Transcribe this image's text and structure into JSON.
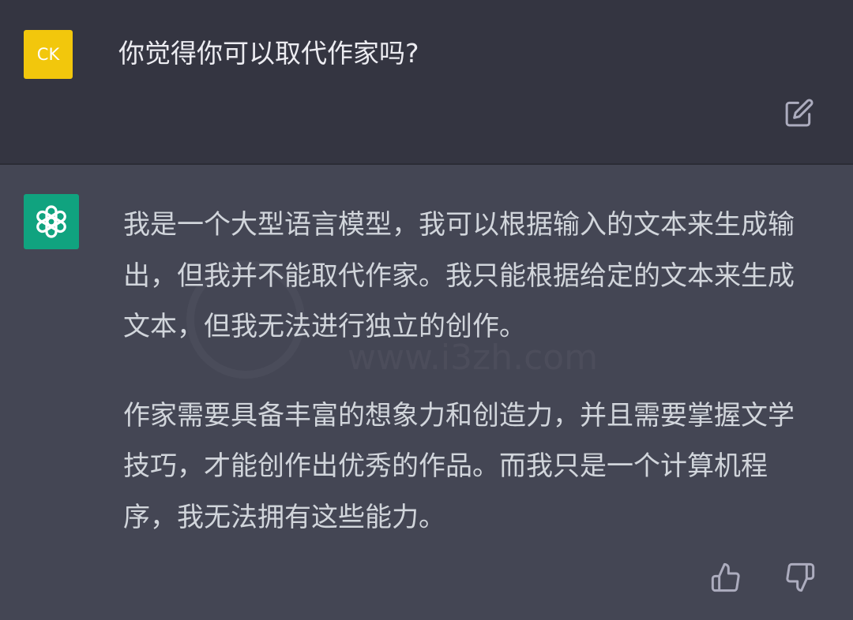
{
  "conversation": {
    "user": {
      "avatar_initials": "CK",
      "avatar_color": "#f2c70c",
      "message": "你觉得你可以取代作家吗?"
    },
    "assistant": {
      "avatar_icon": "openai-logo-icon",
      "avatar_color": "#10a37f",
      "paragraphs": [
        "我是一个大型语言模型，我可以根据输入的文本来生成输出，但我并不能取代作家。我只能根据给定的文本来生成文本，但我无法进行独立的创作。",
        "作家需要具备丰富的想象力和创造力，并且需要掌握文学技巧，才能创作出优秀的作品。而我只是一个计算机程序，我无法拥有这些能力。"
      ]
    }
  },
  "actions": {
    "edit_icon": "edit-icon",
    "thumbs_up_icon": "thumbs-up-icon",
    "thumbs_down_icon": "thumbs-down-icon"
  },
  "watermark": {
    "text": "www.i3zh.com"
  },
  "colors": {
    "user_bg": "#343541",
    "assistant_bg": "#444654",
    "text": "#d1d5db"
  }
}
